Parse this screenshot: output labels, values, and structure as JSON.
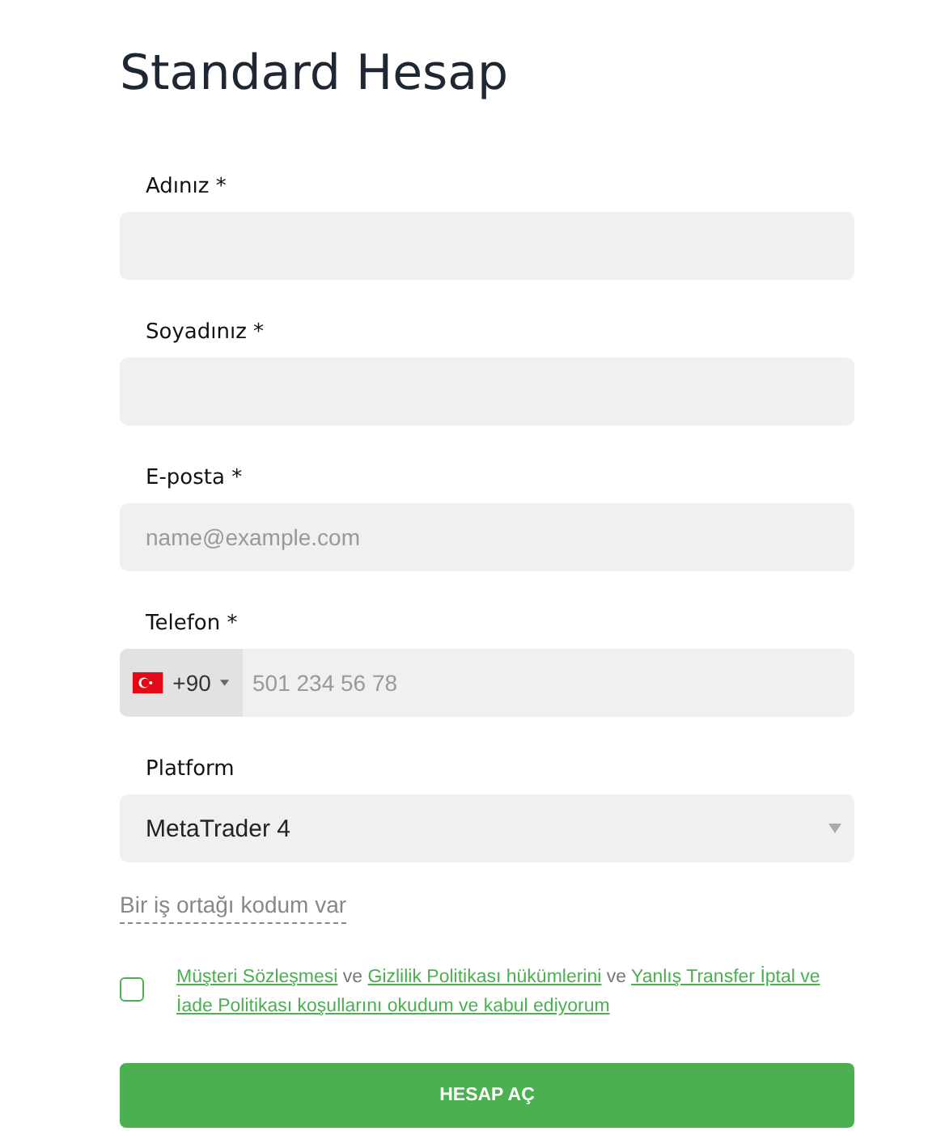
{
  "title": "Standard Hesap",
  "fields": [
    {
      "kind": "text",
      "label": "Adınız *"
    },
    {
      "kind": "text",
      "label": "Soyadınız *"
    },
    {
      "kind": "text",
      "label": "E-posta *",
      "placeholder": "name@example.com"
    },
    {
      "kind": "phone",
      "label": "Telefon *",
      "country_code": "+90",
      "placeholder": "501 234 56 78"
    },
    {
      "kind": "select",
      "label": "Platform",
      "value": "MetaTrader 4"
    }
  ],
  "partner_code_link": "Bir iş ortağı kodum var",
  "consent": {
    "checked": false,
    "parts": [
      {
        "kind": "link",
        "text": "Müşteri Sözleşmesi"
      },
      {
        "kind": "text",
        "text": " ve "
      },
      {
        "kind": "link",
        "text": "Gizlilik Politikası hükümlerini"
      },
      {
        "kind": "text",
        "text": " ve "
      },
      {
        "kind": "link",
        "text": "Yanlış Transfer İptal ve"
      },
      {
        "kind": "link",
        "text": "İade Politikası koşullarını okudum ve kabul ediyorum"
      }
    ]
  },
  "submit_button": "HESAP AÇ"
}
